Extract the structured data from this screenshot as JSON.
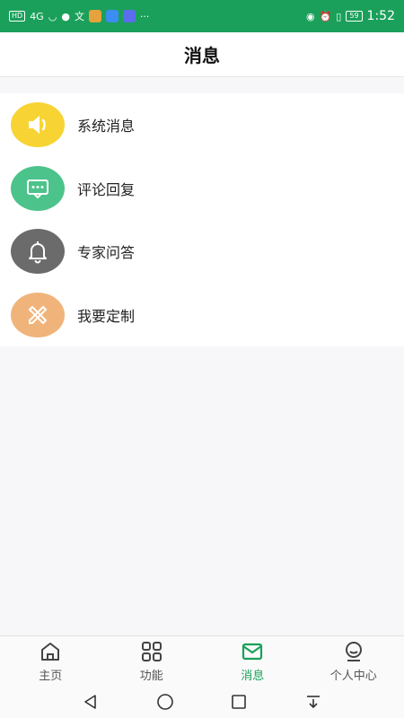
{
  "status_bar": {
    "network": "HD",
    "signal": "4G",
    "battery": "59",
    "time": "1:52",
    "more": "···",
    "color": "#1aa05a"
  },
  "header": {
    "title": "消息"
  },
  "list": {
    "items": [
      {
        "label": "系统消息",
        "icon": "speaker-icon",
        "color": "#f7d434"
      },
      {
        "label": "评论回复",
        "icon": "chat-bubble-icon",
        "color": "#4cc38a"
      },
      {
        "label": "专家问答",
        "icon": "bell-icon",
        "color": "#6b6b6b"
      },
      {
        "label": "我要定制",
        "icon": "pencil-ruler-icon",
        "color": "#f0b47a"
      }
    ]
  },
  "tabbar": {
    "tabs": [
      {
        "label": "主页",
        "icon": "home-icon",
        "active": false
      },
      {
        "label": "功能",
        "icon": "grid-icon",
        "active": false
      },
      {
        "label": "消息",
        "icon": "mail-icon",
        "active": true
      },
      {
        "label": "个人中心",
        "icon": "user-icon",
        "active": false
      }
    ],
    "active_color": "#1aa05a"
  },
  "navbar": {
    "buttons": [
      "back-icon",
      "home-circle-icon",
      "recents-icon",
      "notification-shade-icon"
    ]
  }
}
